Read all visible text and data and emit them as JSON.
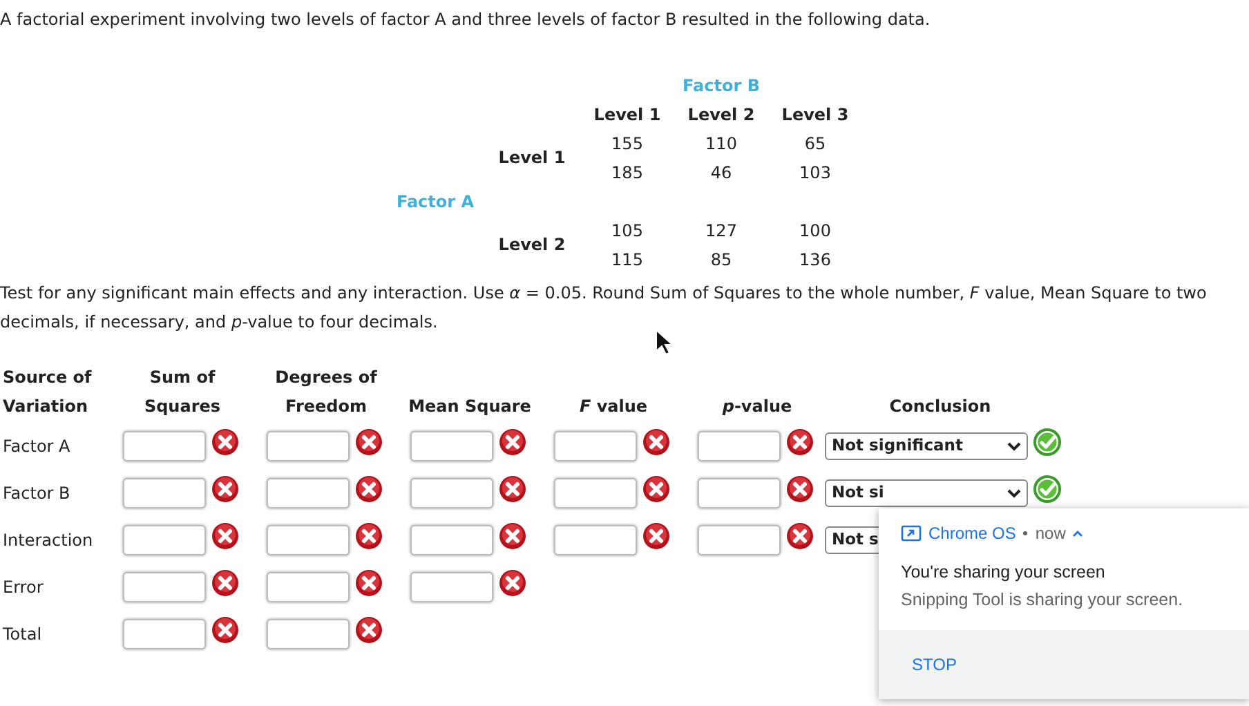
{
  "intro": "A factorial experiment involving two levels of factor A and three levels of factor B resulted in the following data.",
  "data_table": {
    "factor_b_label": "Factor B",
    "factor_a_label": "Factor A",
    "column_headers": [
      "Level 1",
      "Level 2",
      "Level 3"
    ],
    "row_groups": [
      {
        "label": "Level 1",
        "rows": [
          [
            "155",
            "110",
            "65"
          ],
          [
            "185",
            "46",
            "103"
          ]
        ]
      },
      {
        "label": "Level 2",
        "rows": [
          [
            "105",
            "127",
            "100"
          ],
          [
            "115",
            "85",
            "136"
          ]
        ]
      }
    ]
  },
  "instructions": "Test for any significant main effects and any interaction. Use *α* = 0.05. Round Sum of Squares to the whole number, *F* value, Mean Square to two decimals, if necessary, and *p*-value to four decimals.",
  "anova": {
    "columns": [
      "Source of Variation",
      "Sum of Squares",
      "Degrees of Freedom",
      "Mean Square",
      "*F* value",
      "*p*-value",
      "Conclusion"
    ],
    "rows": [
      {
        "source": "Factor A",
        "cells": [
          {
            "correct": false
          },
          {
            "correct": false
          },
          {
            "correct": false
          },
          {
            "correct": false
          },
          {
            "correct": false
          }
        ],
        "conclusion": {
          "value": "Not significant",
          "correct": true
        }
      },
      {
        "source": "Factor B",
        "cells": [
          {
            "correct": false
          },
          {
            "correct": false
          },
          {
            "correct": false
          },
          {
            "correct": false
          },
          {
            "correct": false
          }
        ],
        "conclusion": {
          "value": "Not si",
          "correct": true
        }
      },
      {
        "source": "Interaction",
        "cells": [
          {
            "correct": false
          },
          {
            "correct": false
          },
          {
            "correct": false
          },
          {
            "correct": false
          },
          {
            "correct": false
          }
        ],
        "conclusion": {
          "value": "Not s"
        }
      },
      {
        "source": "Error",
        "cells": [
          {
            "correct": false
          },
          {
            "correct": false
          },
          {
            "correct": false
          }
        ]
      },
      {
        "source": "Total",
        "cells": [
          {
            "correct": false
          },
          {
            "correct": false
          }
        ]
      }
    ]
  },
  "notification": {
    "app": "Chrome OS",
    "time": "now",
    "expanded": true,
    "title": "You're sharing your screen",
    "message": "Snipping Tool is sharing your screen.",
    "action": "STOP"
  }
}
